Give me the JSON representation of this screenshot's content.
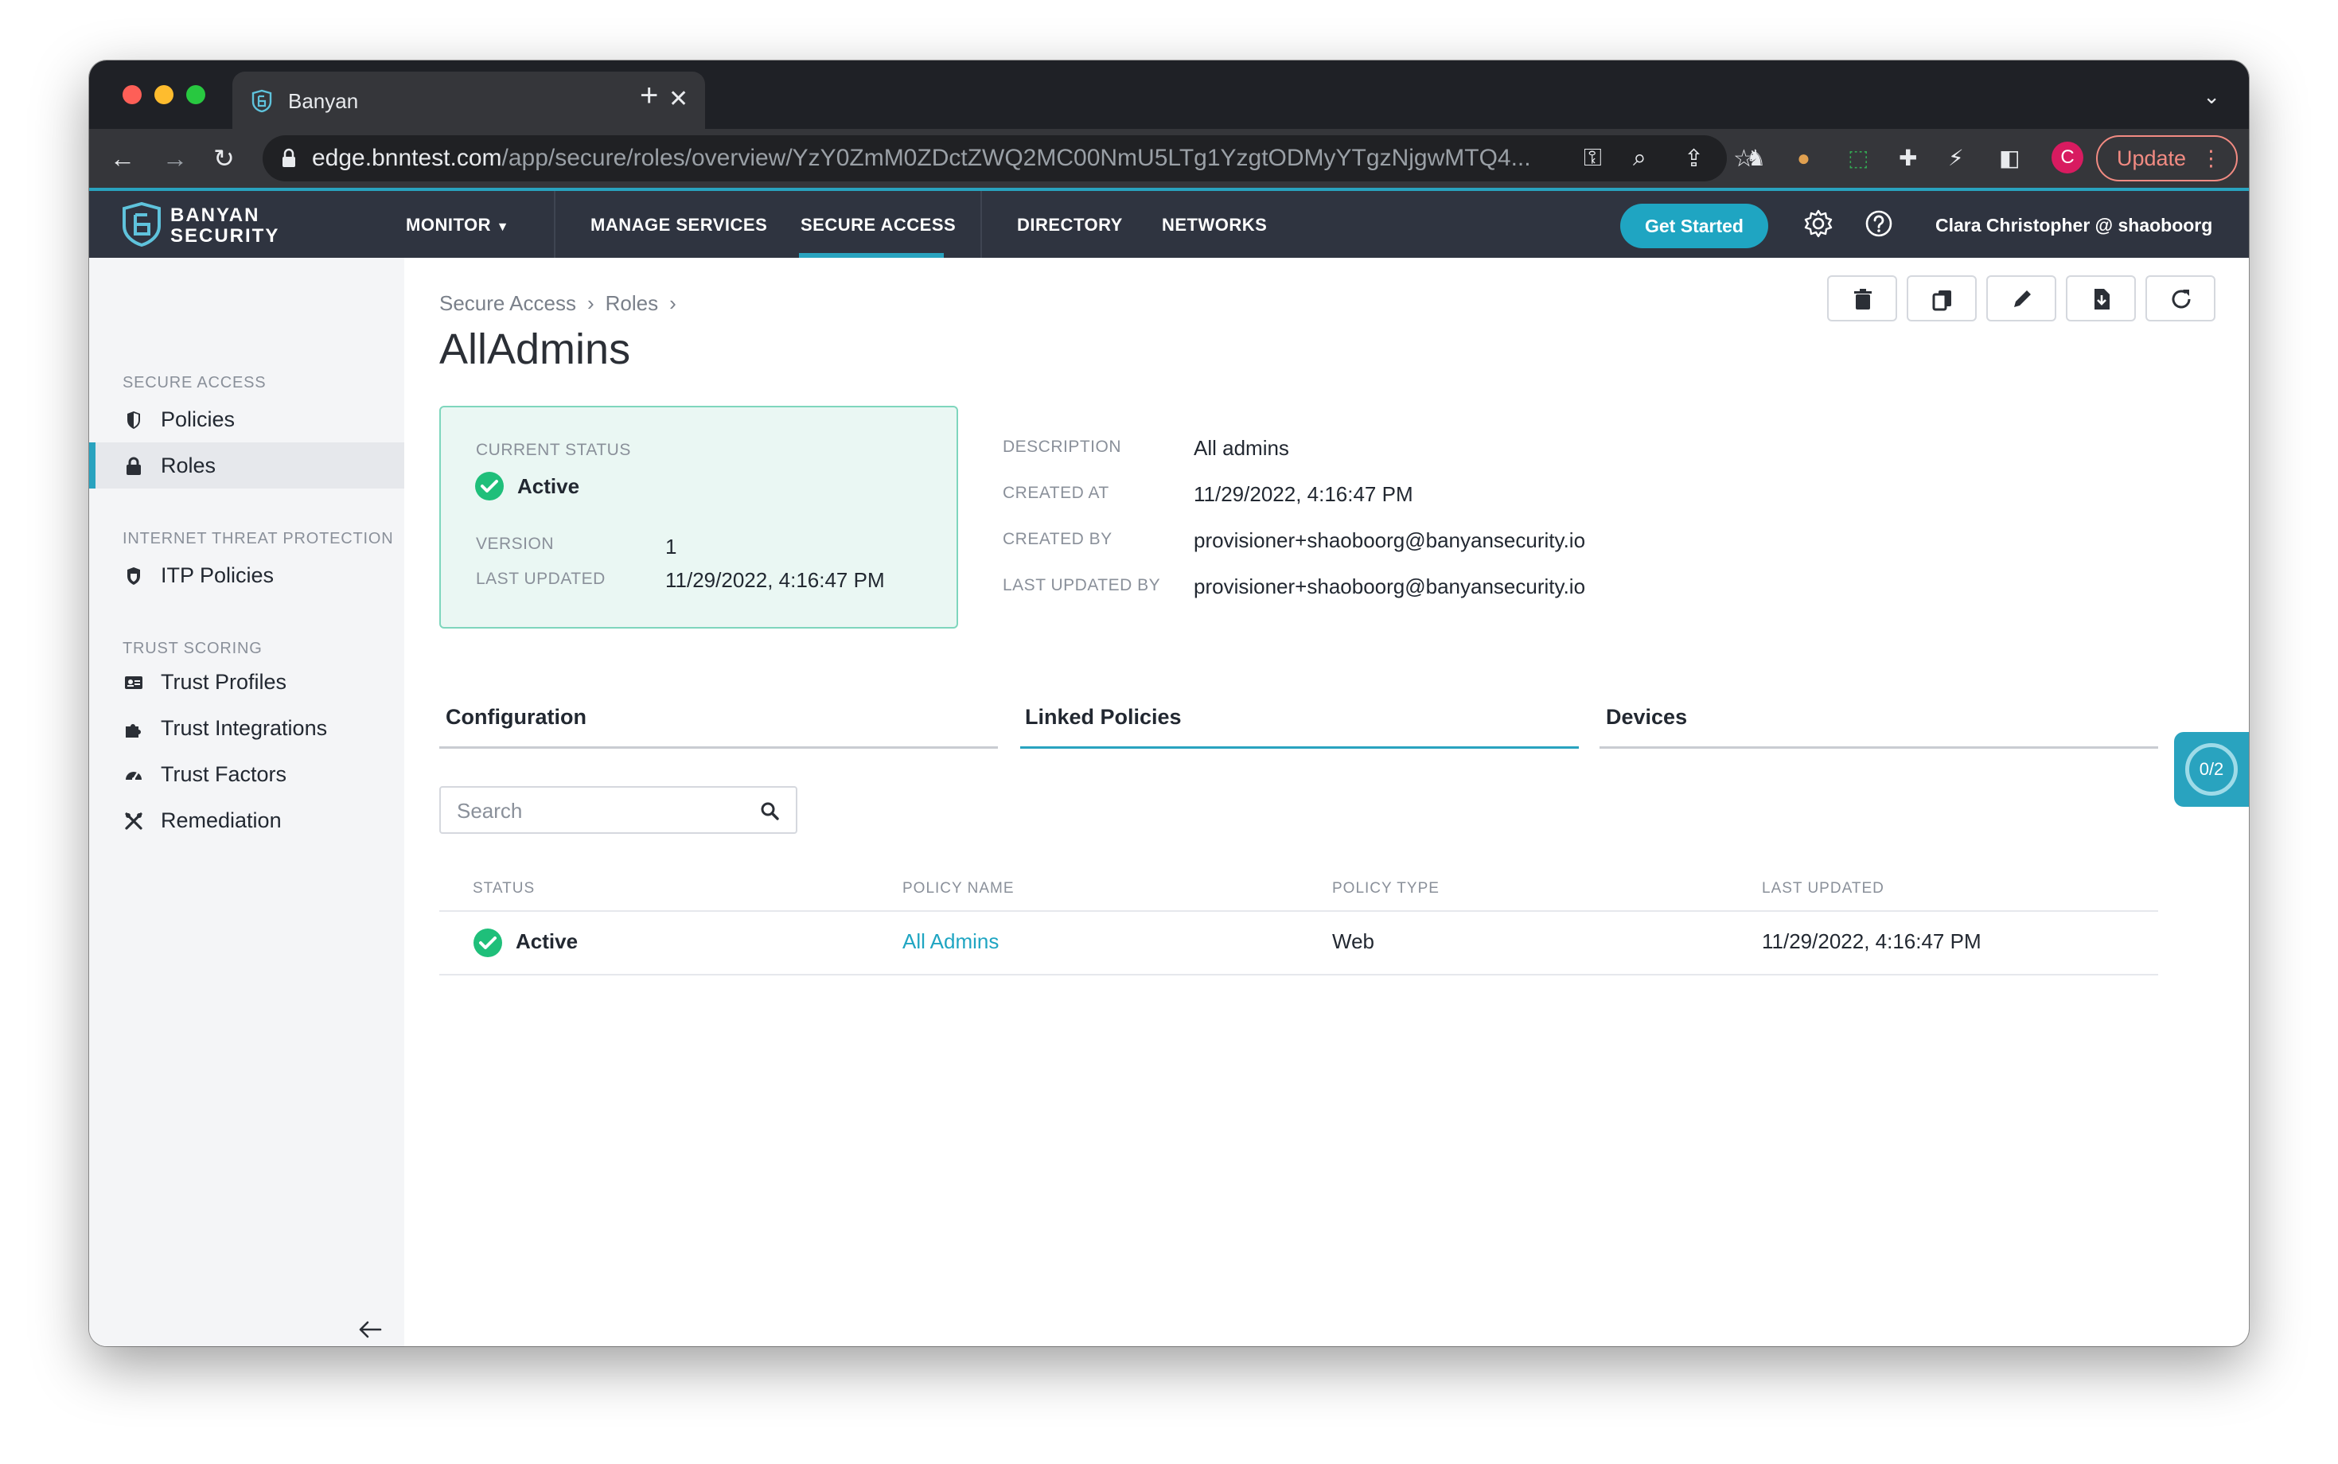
{
  "browser": {
    "tab_title": "Banyan",
    "url_host": "edge.bnntest.com",
    "url_path": "/app/secure/roles/overview/YzY0ZmM0ZDctZWQ2MC00NmU5LTg1YzgtODMyYTgzNjgwMTQ4...",
    "profile_initial": "C",
    "update_label": "Update"
  },
  "header": {
    "brand_line1": "BANYAN",
    "brand_line2": "SECURITY",
    "nav": [
      {
        "label": "MONITOR"
      },
      {
        "label": "MANAGE SERVICES"
      },
      {
        "label": "SECURE ACCESS"
      },
      {
        "label": "DIRECTORY"
      },
      {
        "label": "NETWORKS"
      }
    ],
    "get_started": "Get Started",
    "user": "Clara Christopher @ shaoboorg"
  },
  "sidebar": {
    "sections": [
      {
        "title": "SECURE ACCESS",
        "items": [
          {
            "label": "Policies",
            "icon": "shield-icon"
          },
          {
            "label": "Roles",
            "icon": "lock-icon"
          }
        ]
      },
      {
        "title": "INTERNET THREAT PROTECTION",
        "items": [
          {
            "label": "ITP Policies",
            "icon": "shield-check-icon"
          }
        ]
      },
      {
        "title": "TRUST SCORING",
        "items": [
          {
            "label": "Trust Profiles",
            "icon": "id-card-icon"
          },
          {
            "label": "Trust Integrations",
            "icon": "puzzle-icon"
          },
          {
            "label": "Trust Factors",
            "icon": "gauge-icon"
          },
          {
            "label": "Remediation",
            "icon": "tools-icon"
          }
        ]
      }
    ]
  },
  "main": {
    "breadcrumb": [
      "Secure Access",
      "Roles"
    ],
    "title": "AllAdmins",
    "status_card": {
      "current_status_label": "CURRENT STATUS",
      "current_status": "Active",
      "version_label": "VERSION",
      "version": "1",
      "last_updated_label": "LAST UPDATED",
      "last_updated": "11/29/2022, 4:16:47 PM"
    },
    "meta": {
      "description_label": "DESCRIPTION",
      "description": "All admins",
      "created_at_label": "CREATED AT",
      "created_at": "11/29/2022, 4:16:47 PM",
      "created_by_label": "CREATED BY",
      "created_by": "provisioner+shaoboorg@banyansecurity.io",
      "last_updated_by_label": "LAST UPDATED BY",
      "last_updated_by": "provisioner+shaoboorg@banyansecurity.io"
    },
    "tabs": [
      {
        "label": "Configuration",
        "active": false
      },
      {
        "label": "Linked Policies",
        "active": true
      },
      {
        "label": "Devices",
        "active": false
      }
    ],
    "search": {
      "placeholder": "Search",
      "value": ""
    },
    "table": {
      "columns": [
        "STATUS",
        "POLICY NAME",
        "POLICY TYPE",
        "LAST UPDATED"
      ],
      "rows": [
        {
          "status": "Active",
          "policy_name": "All Admins",
          "policy_type": "Web",
          "last_updated": "11/29/2022, 4:16:47 PM"
        }
      ]
    },
    "progress_badge": "0/2"
  },
  "colors": {
    "accent": "#29a3bf",
    "header_bg": "#2f3440",
    "active_green": "#1fbf7a",
    "status_card_bg": "#eaf7f3"
  }
}
